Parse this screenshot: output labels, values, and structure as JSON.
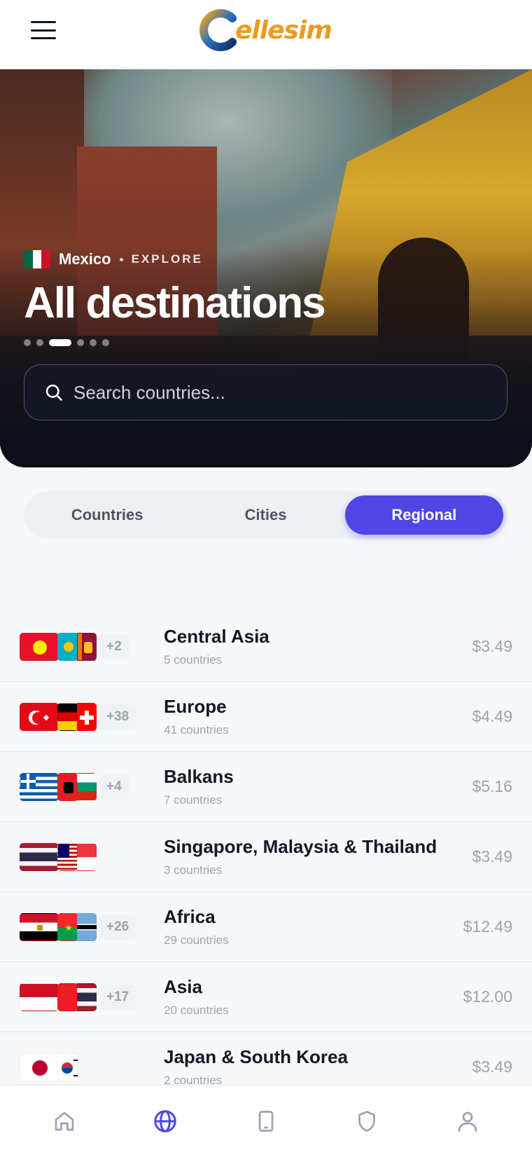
{
  "header": {
    "logo_text": "ellesim",
    "logo_letter": "C"
  },
  "hero": {
    "country": "Mexico",
    "explore_label": "EXPLORE",
    "title": "All destinations",
    "carousel": {
      "total": 6,
      "active_index": 2
    }
  },
  "search": {
    "placeholder": "Search countries..."
  },
  "tabs": [
    {
      "label": "Countries",
      "active": false
    },
    {
      "label": "Cities",
      "active": false
    },
    {
      "label": "Regional",
      "active": true
    }
  ],
  "regions": [
    {
      "name": "Central Asia",
      "count": "5 countries",
      "price": "$3.49",
      "more": "+2"
    },
    {
      "name": "Europe",
      "count": "41 countries",
      "price": "$4.49",
      "more": "+38"
    },
    {
      "name": "Balkans",
      "count": "7 countries",
      "price": "$5.16",
      "more": "+4"
    },
    {
      "name": "Singapore, Malaysia & Thailand",
      "count": "3 countries",
      "price": "$3.49",
      "more": ""
    },
    {
      "name": "Africa",
      "count": "29 countries",
      "price": "$12.49",
      "more": "+26"
    },
    {
      "name": "Asia",
      "count": "20 countries",
      "price": "$12.00",
      "more": "+17"
    },
    {
      "name": "Japan & South Korea",
      "count": "2 countries",
      "price": "$3.49",
      "more": ""
    }
  ],
  "bottom_nav": [
    {
      "icon": "home-icon",
      "active": false
    },
    {
      "icon": "globe-icon",
      "active": true
    },
    {
      "icon": "phone-icon",
      "active": false
    },
    {
      "icon": "shield-icon",
      "active": false
    },
    {
      "icon": "user-icon",
      "active": false
    }
  ],
  "colors": {
    "accent": "#4f46e5",
    "price": "#9ca3af",
    "logo_orange": "#ec9b1f",
    "logo_blue": "#1f5fa8"
  }
}
